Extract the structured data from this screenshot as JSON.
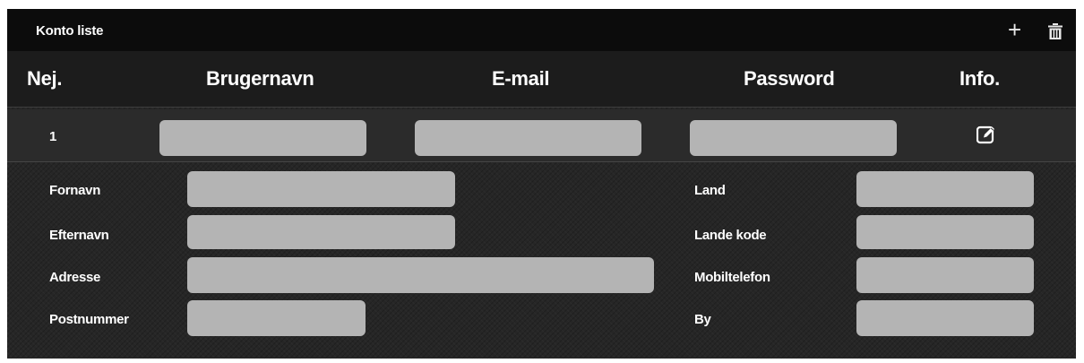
{
  "panel": {
    "title": "Konto liste",
    "add_icon": "plus-icon",
    "delete_icon": "trash-icon"
  },
  "columns": {
    "number": "Nej.",
    "username": "Brugernavn",
    "email": "E-mail",
    "password": "Password",
    "info": "Info."
  },
  "row": {
    "number": "1",
    "username_value": "",
    "email_value": "",
    "password_value": "",
    "edit_icon": "edit-icon"
  },
  "details": {
    "left": [
      {
        "label": "Fornavn",
        "value": ""
      },
      {
        "label": "Efternavn",
        "value": ""
      },
      {
        "label": "Adresse",
        "value": ""
      },
      {
        "label": "Postnummer",
        "value": ""
      }
    ],
    "right": [
      {
        "label": "Land",
        "value": ""
      },
      {
        "label": "Lande kode",
        "value": ""
      },
      {
        "label": "Mobiltelefon",
        "value": ""
      },
      {
        "label": "By",
        "value": ""
      }
    ]
  },
  "colors": {
    "field_bg": "#b4b4b4",
    "title_bar": "#0c0c0c",
    "panel_bg": "#262626",
    "text": "#ffffff"
  }
}
